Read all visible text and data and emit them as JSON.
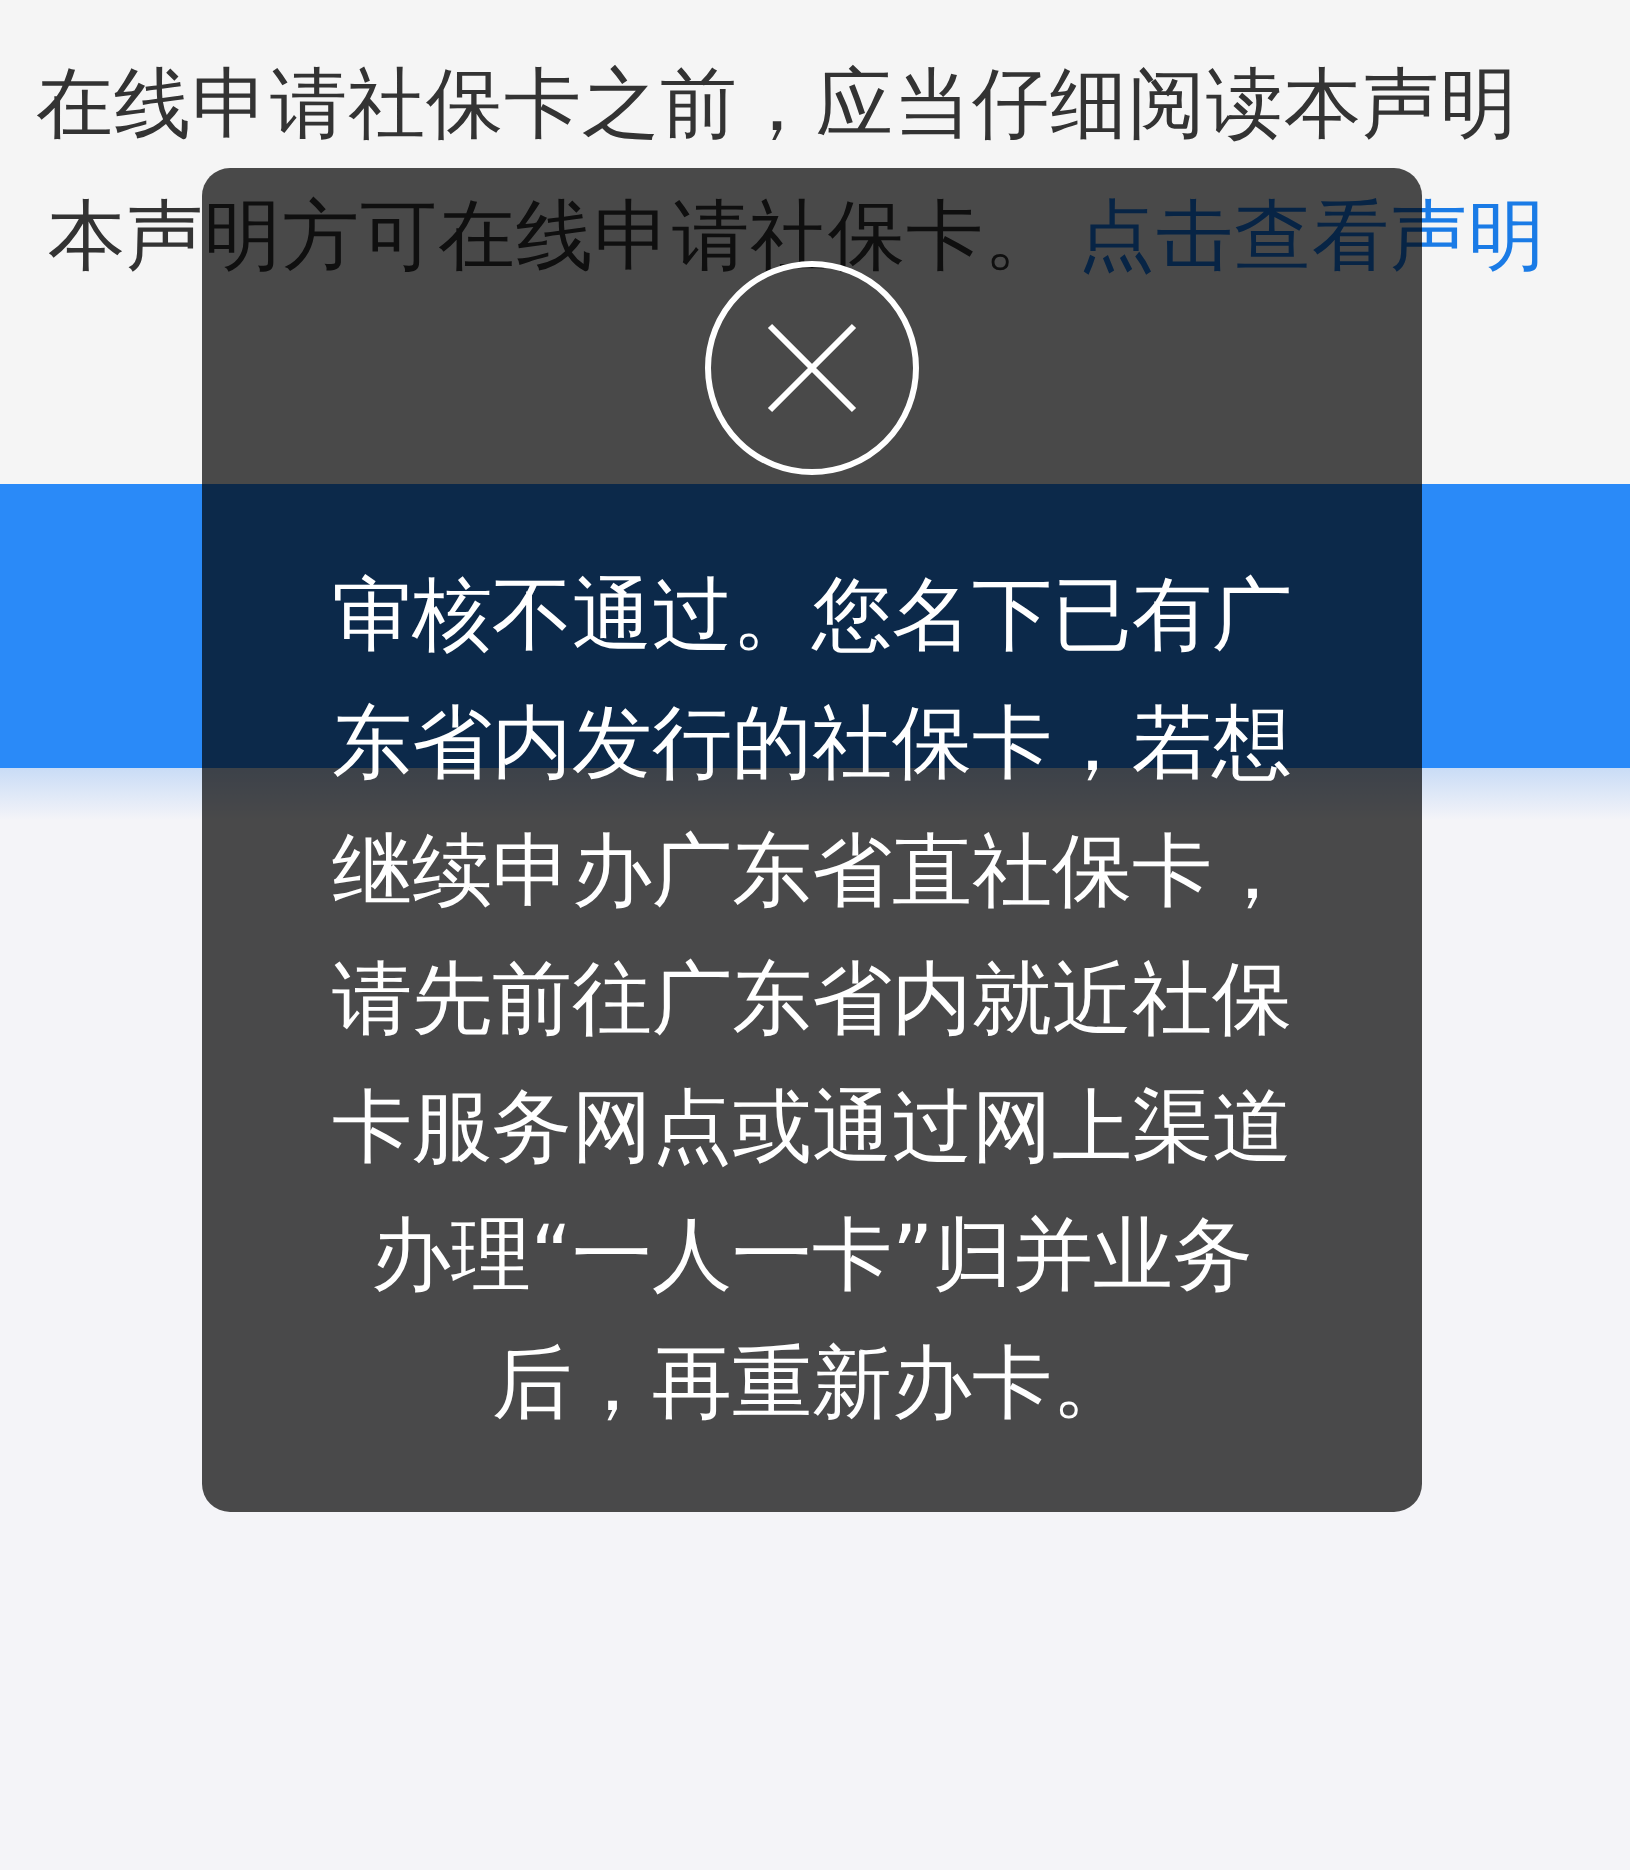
{
  "statement": {
    "line_1": "在线申请社保卡之前，应当仔细阅读本声明",
    "line_2": "本声明方可在线申请社保卡。",
    "link": "点击查看声明"
  },
  "toast": {
    "message": "审核不通过。您名下已有广东省内发行的社保卡，若想继续申办广东省直社保卡，请先前往广东省内就近社保卡服务网点或通过网上渠道办理“一人一卡”归并业务后，再重新办卡。"
  }
}
